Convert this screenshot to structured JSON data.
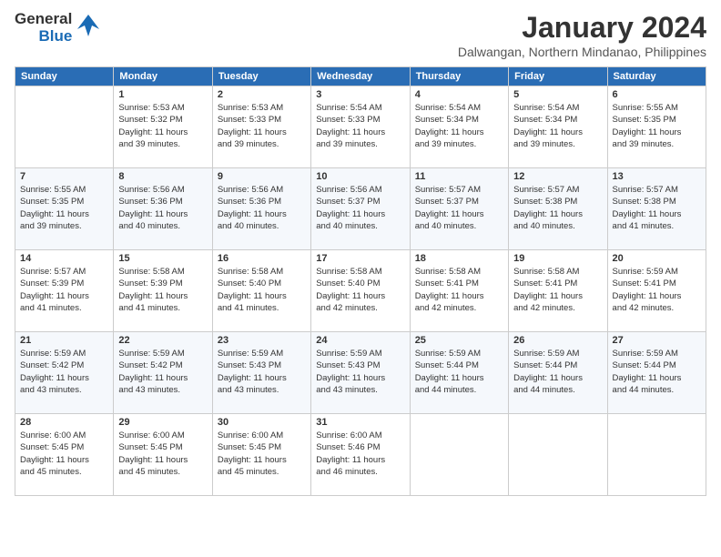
{
  "logo": {
    "general": "General",
    "blue": "Blue"
  },
  "title": "January 2024",
  "location": "Dalwangan, Northern Mindanao, Philippines",
  "days_of_week": [
    "Sunday",
    "Monday",
    "Tuesday",
    "Wednesday",
    "Thursday",
    "Friday",
    "Saturday"
  ],
  "weeks": [
    [
      {
        "day": "",
        "info": ""
      },
      {
        "day": "1",
        "info": "Sunrise: 5:53 AM\nSunset: 5:32 PM\nDaylight: 11 hours\nand 39 minutes."
      },
      {
        "day": "2",
        "info": "Sunrise: 5:53 AM\nSunset: 5:33 PM\nDaylight: 11 hours\nand 39 minutes."
      },
      {
        "day": "3",
        "info": "Sunrise: 5:54 AM\nSunset: 5:33 PM\nDaylight: 11 hours\nand 39 minutes."
      },
      {
        "day": "4",
        "info": "Sunrise: 5:54 AM\nSunset: 5:34 PM\nDaylight: 11 hours\nand 39 minutes."
      },
      {
        "day": "5",
        "info": "Sunrise: 5:54 AM\nSunset: 5:34 PM\nDaylight: 11 hours\nand 39 minutes."
      },
      {
        "day": "6",
        "info": "Sunrise: 5:55 AM\nSunset: 5:35 PM\nDaylight: 11 hours\nand 39 minutes."
      }
    ],
    [
      {
        "day": "7",
        "info": "Sunrise: 5:55 AM\nSunset: 5:35 PM\nDaylight: 11 hours\nand 39 minutes."
      },
      {
        "day": "8",
        "info": "Sunrise: 5:56 AM\nSunset: 5:36 PM\nDaylight: 11 hours\nand 40 minutes."
      },
      {
        "day": "9",
        "info": "Sunrise: 5:56 AM\nSunset: 5:36 PM\nDaylight: 11 hours\nand 40 minutes."
      },
      {
        "day": "10",
        "info": "Sunrise: 5:56 AM\nSunset: 5:37 PM\nDaylight: 11 hours\nand 40 minutes."
      },
      {
        "day": "11",
        "info": "Sunrise: 5:57 AM\nSunset: 5:37 PM\nDaylight: 11 hours\nand 40 minutes."
      },
      {
        "day": "12",
        "info": "Sunrise: 5:57 AM\nSunset: 5:38 PM\nDaylight: 11 hours\nand 40 minutes."
      },
      {
        "day": "13",
        "info": "Sunrise: 5:57 AM\nSunset: 5:38 PM\nDaylight: 11 hours\nand 41 minutes."
      }
    ],
    [
      {
        "day": "14",
        "info": "Sunrise: 5:57 AM\nSunset: 5:39 PM\nDaylight: 11 hours\nand 41 minutes."
      },
      {
        "day": "15",
        "info": "Sunrise: 5:58 AM\nSunset: 5:39 PM\nDaylight: 11 hours\nand 41 minutes."
      },
      {
        "day": "16",
        "info": "Sunrise: 5:58 AM\nSunset: 5:40 PM\nDaylight: 11 hours\nand 41 minutes."
      },
      {
        "day": "17",
        "info": "Sunrise: 5:58 AM\nSunset: 5:40 PM\nDaylight: 11 hours\nand 42 minutes."
      },
      {
        "day": "18",
        "info": "Sunrise: 5:58 AM\nSunset: 5:41 PM\nDaylight: 11 hours\nand 42 minutes."
      },
      {
        "day": "19",
        "info": "Sunrise: 5:58 AM\nSunset: 5:41 PM\nDaylight: 11 hours\nand 42 minutes."
      },
      {
        "day": "20",
        "info": "Sunrise: 5:59 AM\nSunset: 5:41 PM\nDaylight: 11 hours\nand 42 minutes."
      }
    ],
    [
      {
        "day": "21",
        "info": "Sunrise: 5:59 AM\nSunset: 5:42 PM\nDaylight: 11 hours\nand 43 minutes."
      },
      {
        "day": "22",
        "info": "Sunrise: 5:59 AM\nSunset: 5:42 PM\nDaylight: 11 hours\nand 43 minutes."
      },
      {
        "day": "23",
        "info": "Sunrise: 5:59 AM\nSunset: 5:43 PM\nDaylight: 11 hours\nand 43 minutes."
      },
      {
        "day": "24",
        "info": "Sunrise: 5:59 AM\nSunset: 5:43 PM\nDaylight: 11 hours\nand 43 minutes."
      },
      {
        "day": "25",
        "info": "Sunrise: 5:59 AM\nSunset: 5:44 PM\nDaylight: 11 hours\nand 44 minutes."
      },
      {
        "day": "26",
        "info": "Sunrise: 5:59 AM\nSunset: 5:44 PM\nDaylight: 11 hours\nand 44 minutes."
      },
      {
        "day": "27",
        "info": "Sunrise: 5:59 AM\nSunset: 5:44 PM\nDaylight: 11 hours\nand 44 minutes."
      }
    ],
    [
      {
        "day": "28",
        "info": "Sunrise: 6:00 AM\nSunset: 5:45 PM\nDaylight: 11 hours\nand 45 minutes."
      },
      {
        "day": "29",
        "info": "Sunrise: 6:00 AM\nSunset: 5:45 PM\nDaylight: 11 hours\nand 45 minutes."
      },
      {
        "day": "30",
        "info": "Sunrise: 6:00 AM\nSunset: 5:45 PM\nDaylight: 11 hours\nand 45 minutes."
      },
      {
        "day": "31",
        "info": "Sunrise: 6:00 AM\nSunset: 5:46 PM\nDaylight: 11 hours\nand 46 minutes."
      },
      {
        "day": "",
        "info": ""
      },
      {
        "day": "",
        "info": ""
      },
      {
        "day": "",
        "info": ""
      }
    ]
  ]
}
